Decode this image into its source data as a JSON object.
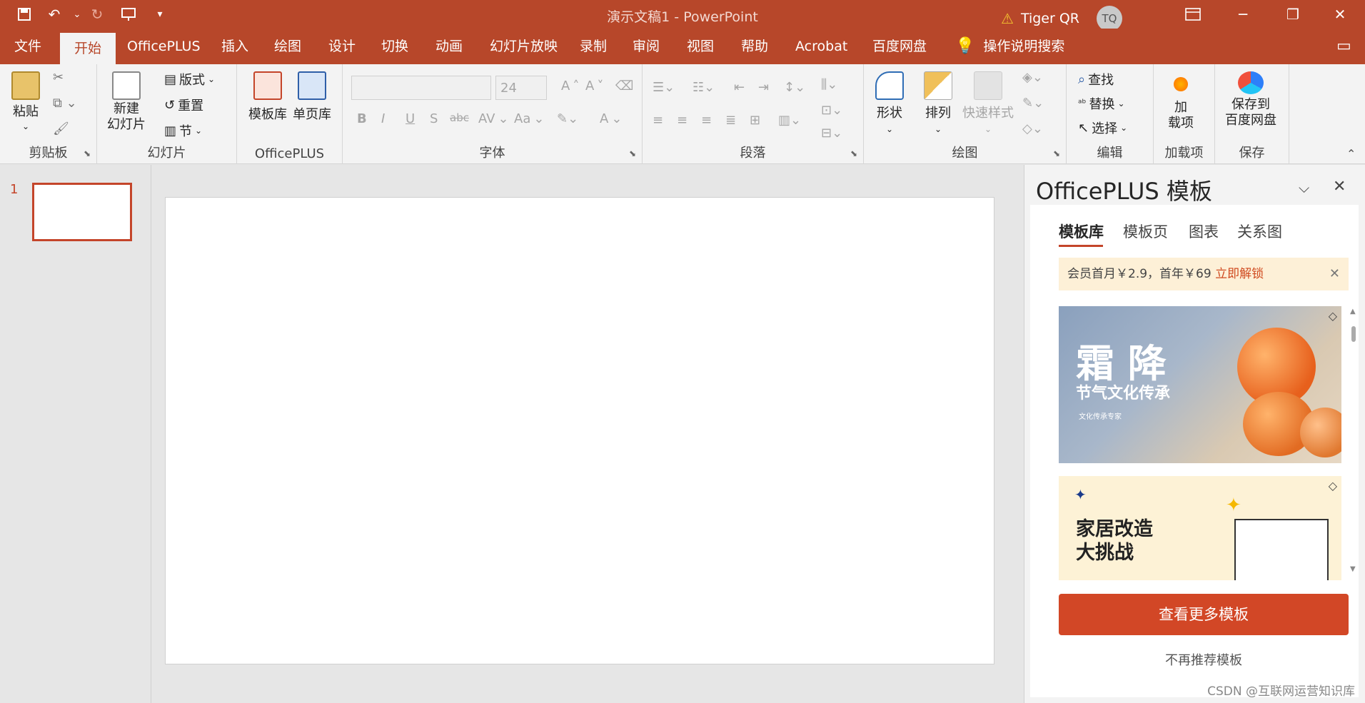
{
  "titlebar": {
    "title": "演示文稿1 - PowerPoint",
    "user_name": "Tiger QR",
    "avatar_initials": "TQ",
    "qat_icons": [
      "save-icon",
      "undo-icon",
      "redo-icon",
      "present-icon",
      "customize-icon"
    ],
    "accent": "#b7472a"
  },
  "tabs": [
    "文件",
    "开始",
    "OfficePLUS",
    "插入",
    "绘图",
    "设计",
    "切换",
    "动画",
    "幻灯片放映",
    "录制",
    "审阅",
    "视图",
    "帮助",
    "Acrobat",
    "百度网盘",
    "操作说明搜索"
  ],
  "ribbon": {
    "clipboard": {
      "paste": "粘贴",
      "label": "剪贴板"
    },
    "slides": {
      "new_slide": "新建\n幻灯片",
      "layout": "版式",
      "reset": "重置",
      "section": "节",
      "label": "幻灯片"
    },
    "officeplus": {
      "template_lib": "模板库",
      "single_page": "单页库",
      "label": "OfficePLUS"
    },
    "font": {
      "font_size": "24",
      "label": "字体",
      "bold": "B",
      "italic": "I",
      "underline": "U",
      "shadow": "S",
      "strike": "abc",
      "spacing": "AV",
      "case": "Aa",
      "grow": "A",
      "shrink": "A",
      "color": "A"
    },
    "paragraph": {
      "label": "段落"
    },
    "drawing": {
      "shapes": "形状",
      "arrange": "排列",
      "quick_styles": "快速样式",
      "label": "绘图"
    },
    "editing": {
      "find": "查找",
      "replace": "替换",
      "select": "选择",
      "label": "编辑"
    },
    "addins": {
      "addin": "加\n载项",
      "label": "加载项"
    },
    "save": {
      "save_baidu": "保存到\n百度网盘",
      "label": "保存"
    }
  },
  "slides_pane": {
    "slide_number": "1"
  },
  "task_pane": {
    "title": "OfficePLUS 模板",
    "tabs": [
      "模板库",
      "模板页",
      "图表",
      "关系图"
    ],
    "promo_text": "会员首月￥2.9，首年￥69",
    "promo_link": "立即解锁",
    "card1_title": "霜 降",
    "card1_sub": "节气文化传承",
    "card1_small": "文化传承专家",
    "card2_title_line1": "家居改造",
    "card2_title_line2": "大挑战",
    "more_button": "查看更多模板",
    "no_recommend": "不再推荐模板"
  },
  "watermark": "CSDN @互联网运营知识库"
}
